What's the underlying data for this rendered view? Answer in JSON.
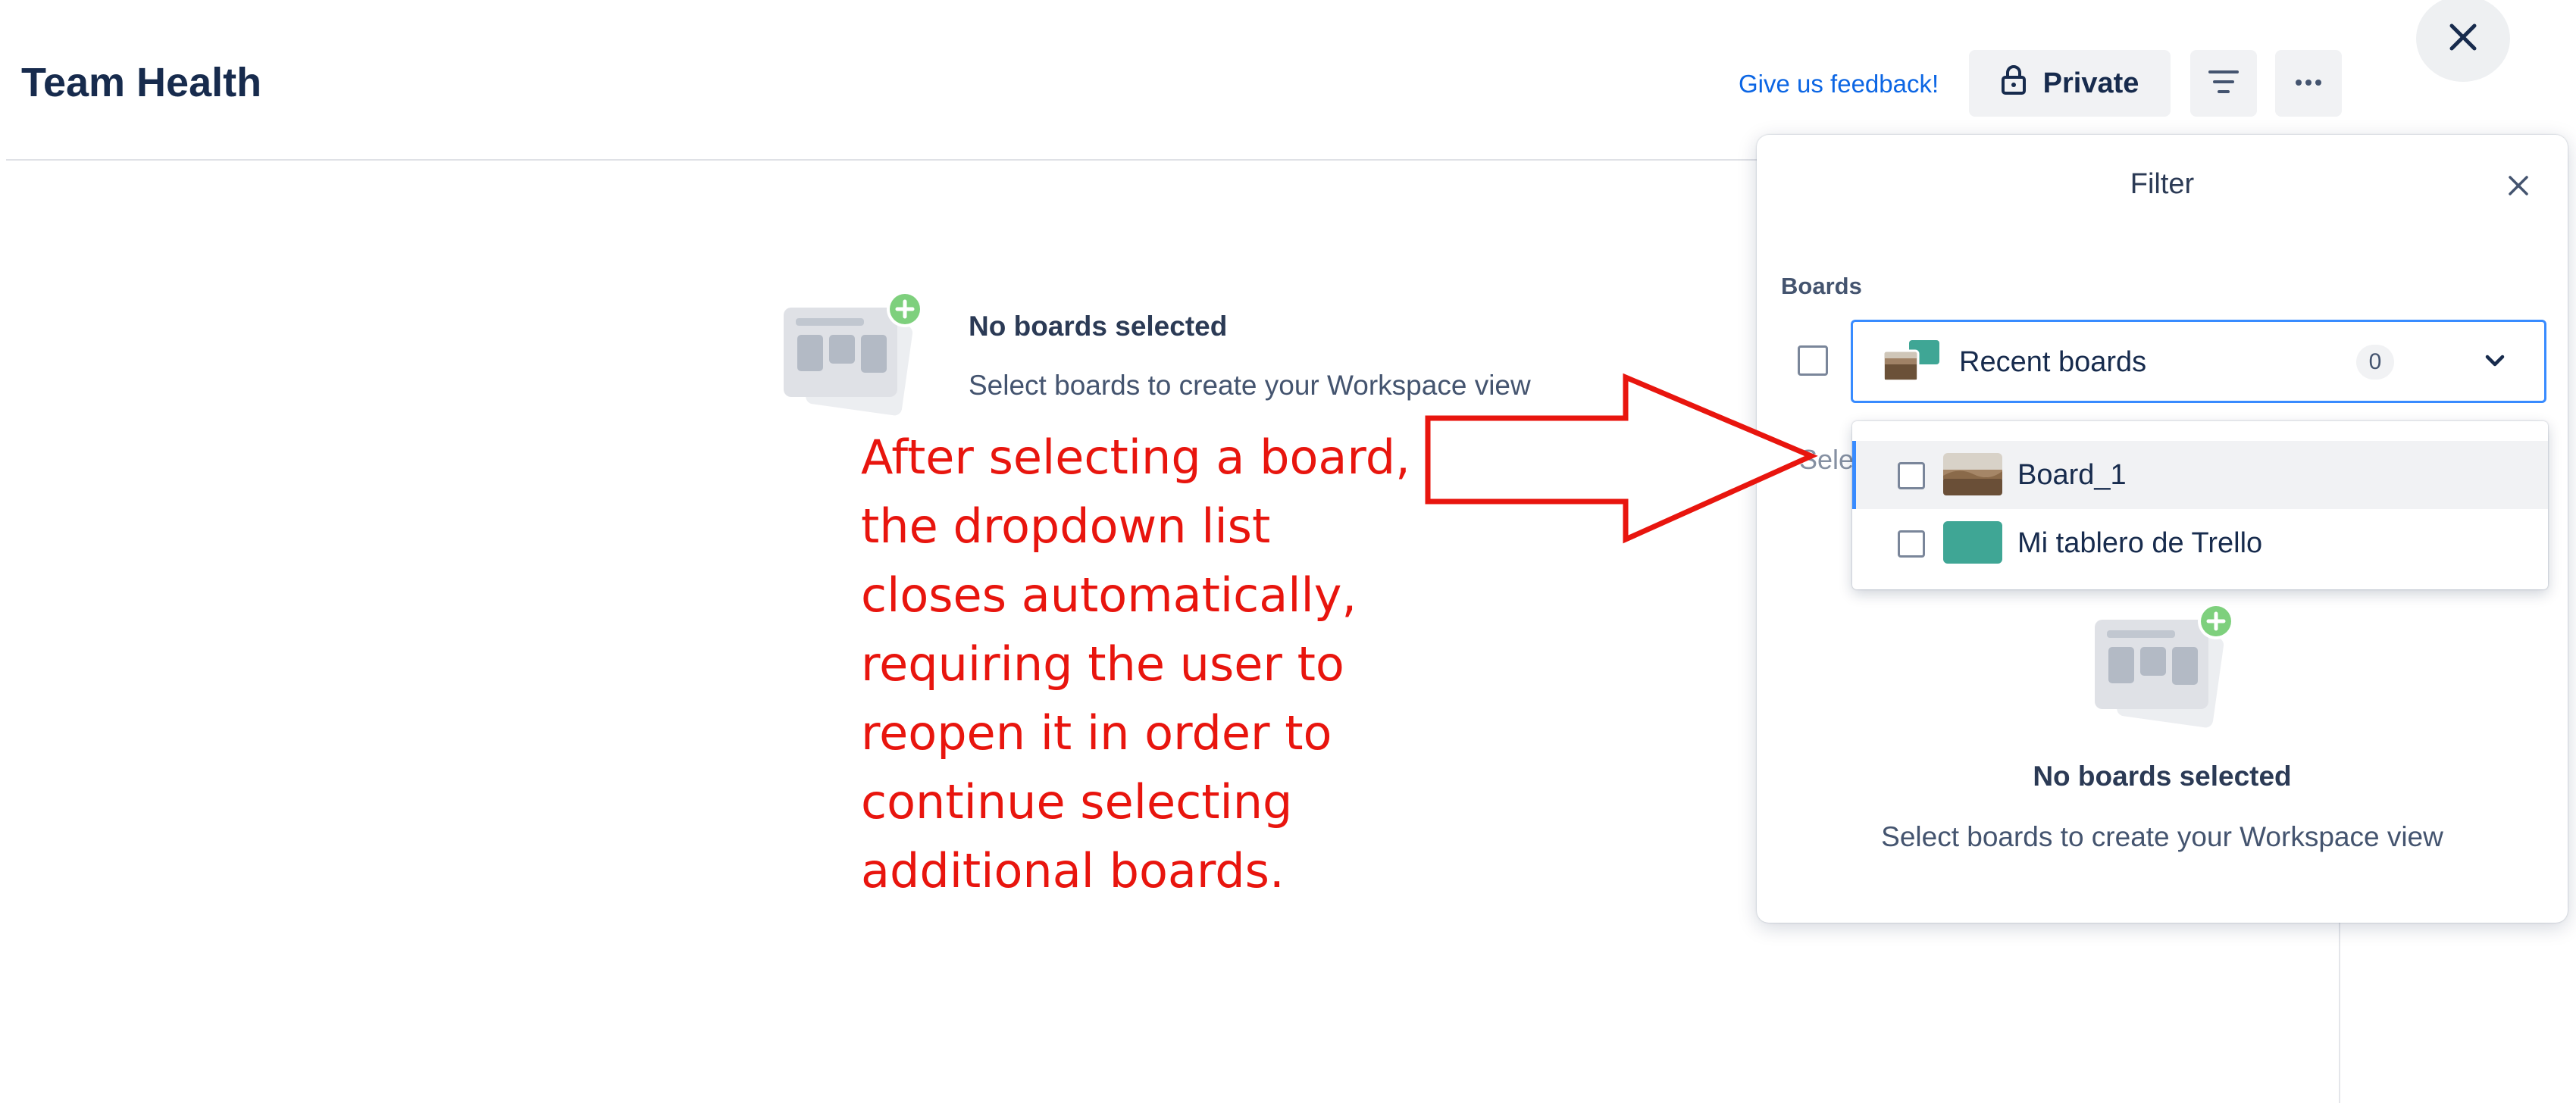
{
  "header": {
    "title": "Team Health",
    "feedback_link": "Give us feedback!",
    "private_button": "Private",
    "filter_icon": "filter-lines-icon",
    "more_icon": "ellipsis-icon",
    "close_icon": "close-icon"
  },
  "main": {
    "empty_title": "No boards selected",
    "empty_description": "Select boards to create your Workspace view"
  },
  "annotation": {
    "lines": [
      "After selecting a board,",
      "the dropdown list",
      "closes automatically,",
      "requiring the user to",
      "reopen it in order to",
      "continue selecting",
      "additional boards."
    ],
    "color": "#e8150e"
  },
  "filter_panel": {
    "title": "Filter",
    "boards_label": "Boards",
    "dropdown": {
      "label": "Recent boards",
      "count": "0"
    },
    "partial_text": "Sele",
    "items": [
      {
        "label": "Board_1",
        "checked": false,
        "thumb_color": "#8a6a4a",
        "highlighted": true
      },
      {
        "label": "Mi tablero de Trello",
        "checked": false,
        "thumb_color": "#3fa695",
        "highlighted": false
      }
    ],
    "empty_title": "No boards selected",
    "empty_description": "Select boards to create your Workspace view"
  },
  "colors": {
    "accent": "#0c66e4",
    "focus_border": "#388bff",
    "annotation_red": "#e8150e",
    "board_teal": "#3fa695"
  }
}
